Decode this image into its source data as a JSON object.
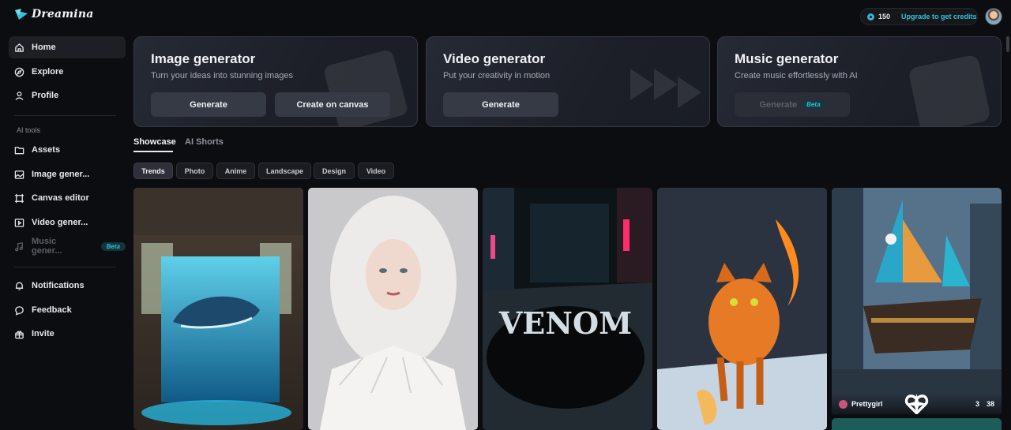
{
  "app": {
    "name": "Dreamina"
  },
  "sidebar": {
    "main": [
      {
        "label": "Home",
        "icon": "home-icon"
      },
      {
        "label": "Explore",
        "icon": "compass-icon"
      },
      {
        "label": "Profile",
        "icon": "user-icon"
      }
    ],
    "ai_tools_label": "AI tools",
    "tools": [
      {
        "label": "Assets",
        "icon": "folder-icon"
      },
      {
        "label": "Image gener...",
        "icon": "image-icon"
      },
      {
        "label": "Canvas editor",
        "icon": "canvas-icon"
      },
      {
        "label": "Video gener...",
        "icon": "video-icon"
      },
      {
        "label": "Music gener...",
        "icon": "music-icon",
        "badge": "Beta"
      }
    ],
    "bottom": [
      {
        "label": "Notifications",
        "icon": "bell-icon"
      },
      {
        "label": "Feedback",
        "icon": "chat-icon"
      },
      {
        "label": "Invite",
        "icon": "gift-icon"
      }
    ]
  },
  "topbar": {
    "credits": "150",
    "upgrade": "Upgrade to get credits"
  },
  "cards": [
    {
      "title": "Image generator",
      "subtitle": "Turn your ideas into stunning images",
      "buttons": [
        "Generate",
        "Create on canvas"
      ]
    },
    {
      "title": "Video generator",
      "subtitle": "Put your creativity in motion",
      "buttons": [
        "Generate"
      ]
    },
    {
      "title": "Music generator",
      "subtitle": "Create music effortlessly with AI",
      "buttons": [
        "Generate"
      ],
      "badge": "Beta"
    }
  ],
  "tabs": [
    "Showcase",
    "AI Shorts"
  ],
  "filters": [
    "Trends",
    "Photo",
    "Anime",
    "Landscape",
    "Design",
    "Video"
  ],
  "gallery": {
    "tiles": [
      {
        "subject": "whale-painting"
      },
      {
        "subject": "elf-portrait"
      },
      {
        "subject": "venom-street"
      },
      {
        "subject": "fire-cat"
      },
      {
        "subject": "pirate-ship",
        "author": "Prettygirl",
        "likes": "3",
        "remixes": "38"
      }
    ]
  },
  "colors": {
    "accent": "#35c2dd",
    "background": "#0c0d10",
    "card": "#22252e"
  }
}
